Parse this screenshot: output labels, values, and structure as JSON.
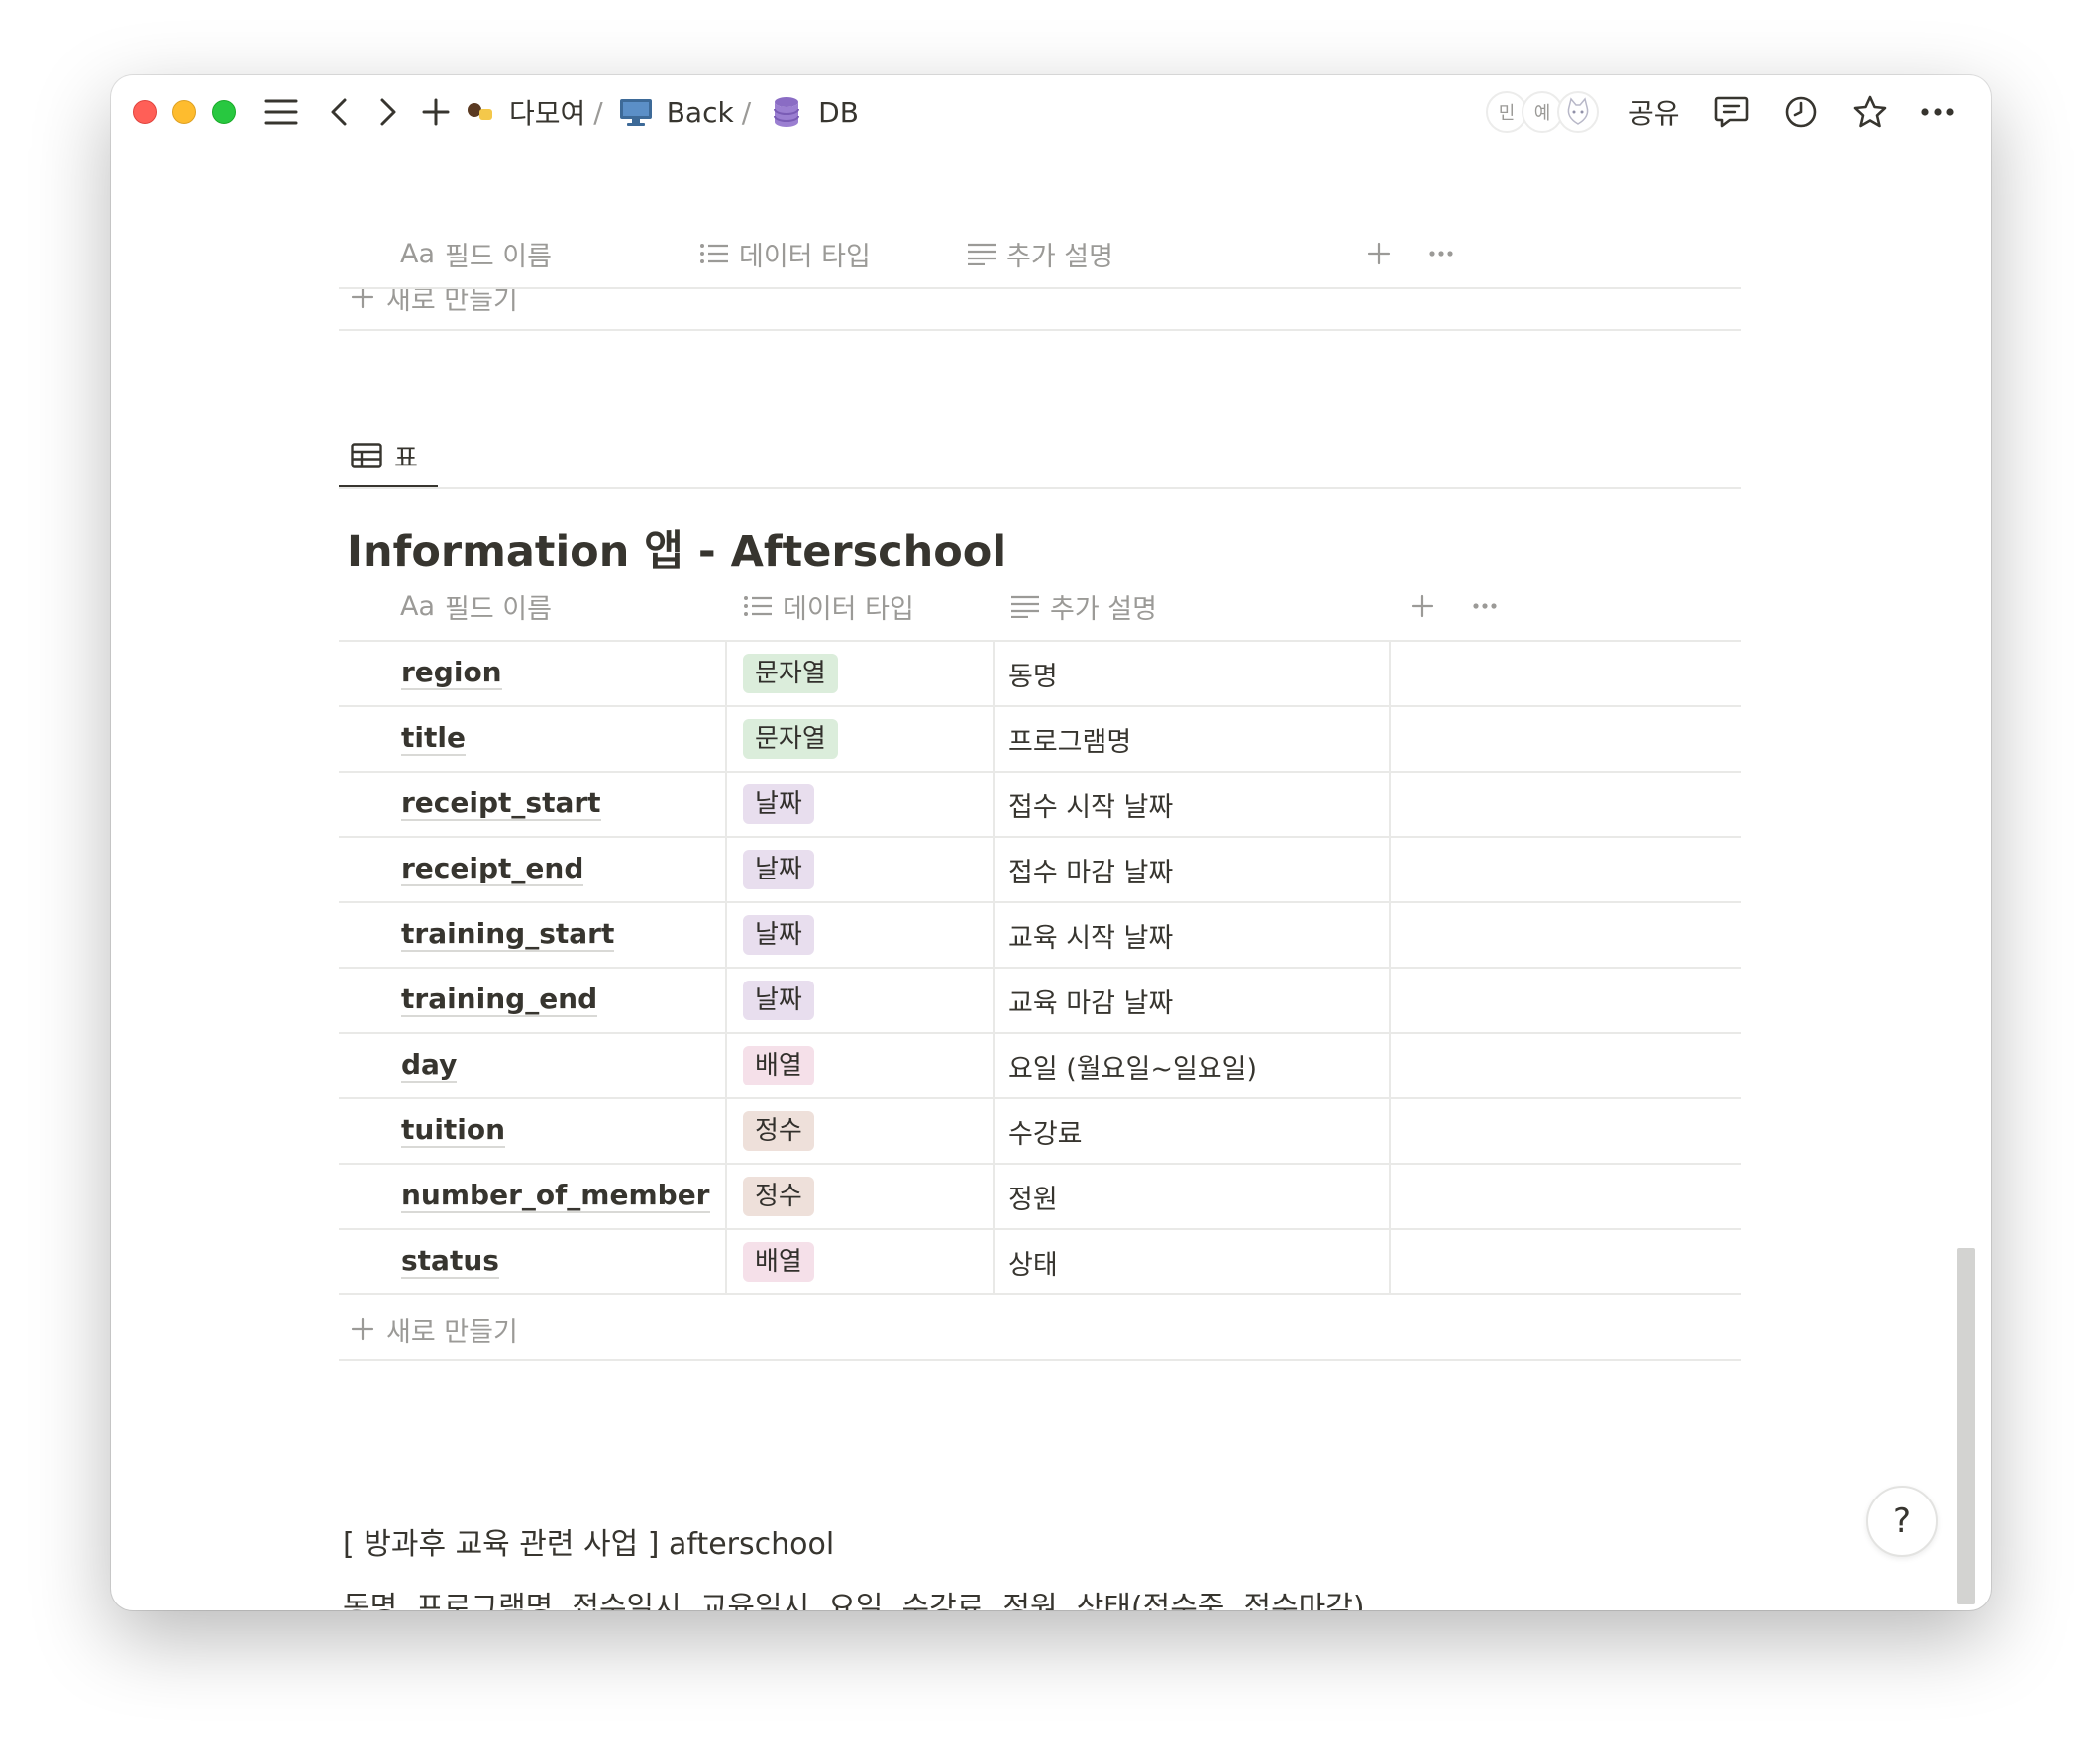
{
  "breadcrumb": {
    "workspace": "다모여",
    "parent": "Back",
    "page": "DB",
    "sep": "/"
  },
  "avatars": [
    "민",
    "예"
  ],
  "topbar": {
    "share_label": "공유"
  },
  "columns": {
    "name_prefix": "Aa",
    "name": "필드 이름",
    "type": "데이터 타입",
    "desc": "추가 설명"
  },
  "view": {
    "tab_label": "표"
  },
  "database": {
    "title": "Information 앱 - Afterschool"
  },
  "rows": [
    {
      "name": "region",
      "type": "문자열",
      "type_color": "#dbeddb",
      "desc": "동명"
    },
    {
      "name": "title",
      "type": "문자열",
      "type_color": "#dbeddb",
      "desc": "프로그램명"
    },
    {
      "name": "receipt_start",
      "type": "날짜",
      "type_color": "#e8deee",
      "desc": "접수 시작 날짜"
    },
    {
      "name": "receipt_end",
      "type": "날짜",
      "type_color": "#e8deee",
      "desc": "접수 마감 날짜"
    },
    {
      "name": "training_start",
      "type": "날짜",
      "type_color": "#e8deee",
      "desc": "교육 시작 날짜"
    },
    {
      "name": "training_end",
      "type": "날짜",
      "type_color": "#e8deee",
      "desc": "교육 마감 날짜"
    },
    {
      "name": "day",
      "type": "배열",
      "type_color": "#f5e0e9",
      "desc": "요일 (월요일~일요일)"
    },
    {
      "name": "tuition",
      "type": "정수",
      "type_color": "#eee0da",
      "desc": "수강료"
    },
    {
      "name": "number_of_member",
      "type": "정수",
      "type_color": "#eee0da",
      "desc": "정원"
    },
    {
      "name": "status",
      "type": "배열",
      "type_color": "#f5e0e9",
      "desc": "상태"
    }
  ],
  "new_row_label": "새로 만들기",
  "body": {
    "line1": "[ 방과후 교육 관련 사업 ] afterschool",
    "line2": "동명, 프로그램명, 접수일시, 교육일시, 요일, 수강료, 정원, 상태(접수중, 접수마감)"
  },
  "help": {
    "label": "?"
  }
}
